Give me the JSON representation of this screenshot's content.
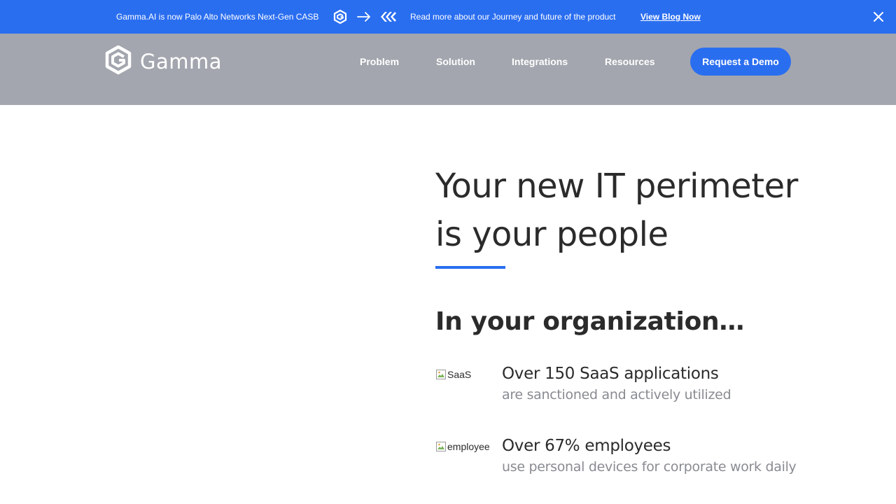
{
  "banner": {
    "text": "Gamma.AI is now Palo Alto Networks Next-Gen CASB",
    "icons": [
      "gamma-logo-icon",
      "arrow-right-icon",
      "palo-alto-logo-icon"
    ],
    "text2": "Read more about our Journey and future of the product",
    "link": "View Blog Now",
    "close_icon": "close-icon",
    "color": "#2a6ef0"
  },
  "header": {
    "logo_text": "Gamma",
    "logo_icon": "gamma-hexagon-icon",
    "nav": [
      {
        "label": "Problem"
      },
      {
        "label": "Solution"
      },
      {
        "label": "Integrations"
      },
      {
        "label": "Resources"
      }
    ],
    "cta": "Request a Demo",
    "background": "#a3a6ae"
  },
  "hero": {
    "title_line1": "Your new IT perimeter",
    "title_line2": "is your people",
    "accent": "#2a6ef0"
  },
  "organization": {
    "heading": "In your organization…",
    "stats": [
      {
        "img_alt": "SaaS",
        "main": "Over 150 SaaS applications",
        "sub": "are sanctioned and actively utilized"
      },
      {
        "img_alt": "employee",
        "main": "Over 67% employees",
        "sub": "use personal devices for corporate work daily"
      }
    ]
  }
}
